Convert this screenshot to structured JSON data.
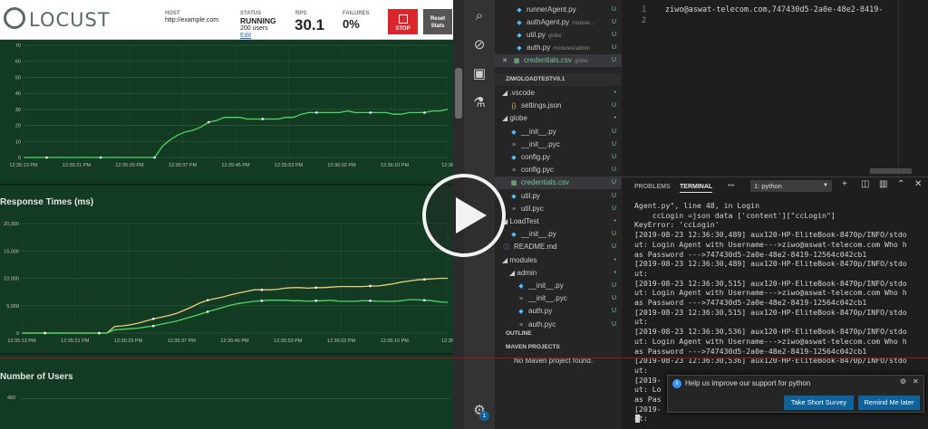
{
  "locust": {
    "logo": "LOCUST",
    "host_label": "HOST",
    "host_value": "http://example.com",
    "status_label": "STATUS",
    "status_value": "RUNNING",
    "users_text": "200 users",
    "edit_link": "Edit",
    "rps_label": "RPS",
    "rps_value": "30.1",
    "failures_label": "FAILURES",
    "failures_value": "0%",
    "stop_label": "STOP",
    "reset_label_1": "Reset",
    "reset_label_2": "Stats",
    "response_title": "Response Times (ms)",
    "users_chart_title": "Number of Users",
    "users_chart_ytick": "400"
  },
  "chart_data": [
    {
      "type": "line",
      "title": "",
      "x": [
        "12:35:13 PM",
        "12:35:21 PM",
        "12:35:29 PM",
        "12:35:37 PM",
        "12:35:45 PM",
        "12:35:53 PM",
        "12:36:02 PM",
        "12:36:10 PM",
        "12:36"
      ],
      "yticks": [
        0,
        10,
        20,
        30,
        40,
        50,
        60,
        70
      ],
      "ylim": [
        0,
        70
      ],
      "series": [
        {
          "color": "#4cd964",
          "values": [
            0,
            0,
            0,
            0,
            0,
            0,
            0,
            0,
            0,
            0,
            0,
            0,
            0,
            0,
            0,
            0,
            0,
            0,
            7,
            11,
            14,
            16,
            17,
            19,
            22,
            23,
            25,
            25,
            25,
            24,
            24,
            24,
            24,
            24,
            25,
            25,
            27,
            28,
            28,
            28,
            28,
            28,
            29,
            28,
            28,
            28,
            28,
            28,
            27,
            27,
            28,
            28,
            28,
            29,
            29,
            30
          ]
        }
      ],
      "grid": true
    },
    {
      "type": "line",
      "title": "Response Times (ms)",
      "x": [
        "12:35:13 PM",
        "12:35:21 PM",
        "12:35:29 PM",
        "12:35:37 PM",
        "12:35:45 PM",
        "12:35:53 PM",
        "12:36:02 PM",
        "12:36:10 PM",
        "12:36"
      ],
      "yticks": [
        "0",
        "5,000",
        "10,000",
        "15,000",
        "20,000"
      ],
      "ylim": [
        0,
        20000
      ],
      "series": [
        {
          "color": "#e8d07a",
          "values": [
            0,
            0,
            0,
            0,
            0,
            0,
            0,
            0,
            0,
            0,
            0,
            0,
            1200,
            1300,
            1500,
            1800,
            2200,
            2600,
            2900,
            3200,
            3600,
            4200,
            4800,
            5500,
            6000,
            6300,
            6600,
            7000,
            7300,
            7600,
            7900,
            7900,
            7900,
            8000,
            8200,
            8300,
            8300,
            8200,
            8300,
            8300,
            8400,
            8500,
            8500,
            8500,
            8500,
            8600,
            8600,
            8800,
            9000,
            9300,
            9500,
            9700,
            9800,
            9900,
            10000,
            10000
          ]
        },
        {
          "color": "#4cd964",
          "values": [
            0,
            0,
            0,
            0,
            0,
            0,
            0,
            0,
            0,
            0,
            0,
            0,
            600,
            700,
            800,
            900,
            1100,
            1300,
            1600,
            1900,
            2200,
            2600,
            3000,
            3400,
            3900,
            4300,
            4700,
            5100,
            5400,
            5600,
            5800,
            5900,
            6000,
            6000,
            6000,
            5900,
            5900,
            5800,
            5900,
            5900,
            6000,
            5800,
            5800,
            5800,
            5900,
            5900,
            5800,
            5800,
            5800,
            5900,
            6100,
            6100,
            6000,
            5900,
            5700,
            5600
          ]
        }
      ],
      "grid": true
    },
    {
      "type": "line",
      "title": "Number of Users",
      "yticks": [
        "400"
      ],
      "series": []
    }
  ],
  "vscode": {
    "sidebar": {
      "open_editors": [
        {
          "name": "runnerAgent.py",
          "sub": "",
          "status": "U"
        },
        {
          "name": "authAgent.py",
          "sub": "module...",
          "status": "U"
        },
        {
          "name": "util.py",
          "sub": "globe",
          "status": "U"
        },
        {
          "name": "auth.py",
          "sub": "modules/admin",
          "status": "U"
        },
        {
          "name": "credentials.csv",
          "sub": "globe",
          "status": "U"
        }
      ],
      "workspace_title": "ZIWOLOADTESTV0.1",
      "tree": [
        {
          "label": "◢ .vscode",
          "indent": 1,
          "icon": "",
          "status": "•"
        },
        {
          "label": "settings.json",
          "indent": 2,
          "icon": "{}",
          "status": "U"
        },
        {
          "label": "◢ globe",
          "indent": 1,
          "icon": "",
          "status": "•"
        },
        {
          "label": "__init__.py",
          "indent": 2,
          "icon": "py",
          "status": "U"
        },
        {
          "label": "__init__.pyc",
          "indent": 2,
          "icon": "pyc",
          "status": "U"
        },
        {
          "label": "config.py",
          "indent": 2,
          "icon": "py",
          "status": "U"
        },
        {
          "label": "config.pyc",
          "indent": 2,
          "icon": "pyc",
          "status": "U"
        },
        {
          "label": "credentials.csv",
          "indent": 2,
          "icon": "csv",
          "status": "U"
        },
        {
          "label": "util.py",
          "indent": 2,
          "icon": "py",
          "status": "U"
        },
        {
          "label": "util.pyc",
          "indent": 2,
          "icon": "pyc",
          "status": "U"
        },
        {
          "label": "◢ LoadTest",
          "indent": 1,
          "icon": "",
          "status": "•"
        },
        {
          "label": "__init__.py",
          "indent": 2,
          "icon": "py",
          "status": "U"
        },
        {
          "label": "README.md",
          "indent": 1,
          "icon": "md",
          "status": "U"
        },
        {
          "label": "◢ modules",
          "indent": 1,
          "icon": "",
          "status": "•"
        },
        {
          "label": "◢ admin",
          "indent": 2,
          "icon": "",
          "status": "•"
        },
        {
          "label": "__init__.py",
          "indent": 3,
          "icon": "py",
          "status": "U"
        },
        {
          "label": "__init__.pyc",
          "indent": 3,
          "icon": "pyc",
          "status": "U"
        },
        {
          "label": "auth.py",
          "indent": 3,
          "icon": "py",
          "status": "U"
        },
        {
          "label": "auth.pyc",
          "indent": 3,
          "icon": "pyc",
          "status": "U"
        }
      ],
      "outline": "OUTLINE",
      "maven": "MAVEN PROJECTS",
      "maven_empty": "No Maven project found."
    },
    "editor": {
      "line_numbers": [
        "1",
        "2"
      ],
      "line1": "ziwo@aswat-telecom.com,747430d5-2a0e-48e2-8419-"
    },
    "panel": {
      "tab_problems": "PROBLEMS",
      "tab_terminal": "TERMINAL",
      "more": "•••",
      "terminal_select": "1: python",
      "terminal_lines": [
        "Agent.py\", line 48, in Login",
        "    ccLogin =json data ['content'][\"ccLogin\"]",
        "KeyError: 'ccLogin'",
        "[2019-08-23 12:36:30,489] aux120-HP-EliteBook-8470p/INFO/stdo",
        "ut: Login Agent with Username--->ziwo@aswat-telecom.com Who h",
        "as Password --->747430d5-2a0e-48e2-8419-12564c042cb1",
        "[2019-08-23 12:36:30,489] aux120-HP-EliteBook-8470p/INFO/stdo",
        "ut:",
        "[2019-08-23 12:36:30,515] aux120-HP-EliteBook-8470p/INFO/stdo",
        "ut: Login Agent with Username--->ziwo@aswat-telecom.com Who h",
        "as Password --->747430d5-2a0e-48e2-8419-12564c042cb1",
        "[2019-08-23 12:36:30,515] aux120-HP-EliteBook-8470p/INFO/stdo",
        "ut:",
        "[2019-08-23 12:36:30,536] aux120-HP-EliteBook-8470p/INFO/stdo",
        "ut: Login Agent with Username--->ziwo@aswat-telecom.com Who h",
        "as Password --->747430d5-2a0e-48e2-8419-12564c042cb1",
        "[2019-08-23 12:36:30,536] aux120-HP-EliteBook-8470p/INFO/stdo",
        "ut:",
        "[2019-",
        "ut: Lo",
        "as Pas",
        "[2019-",
        "ut:"
      ]
    },
    "notification": {
      "message": "Help us improve our support for python",
      "survey_button": "Take Short Survey",
      "later_button": "Remind Me later",
      "badge": "1"
    }
  }
}
